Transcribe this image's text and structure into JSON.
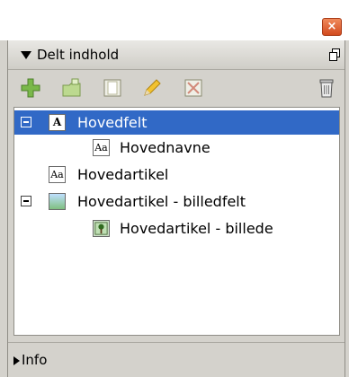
{
  "panel": {
    "title": "Delt indhold",
    "close_label": "×"
  },
  "toolbar": {
    "icons": [
      "plus-icon",
      "new-folder-icon",
      "frame-icon",
      "pencil-icon",
      "unlink-icon",
      "trash-icon"
    ]
  },
  "tree": {
    "items": [
      {
        "label": "Hovedfelt",
        "icon": "A",
        "selected": true
      },
      {
        "label": "Hovednavne",
        "icon": "Aa"
      },
      {
        "label": "Hovedartikel",
        "icon": "Aa"
      },
      {
        "label": "Hovedartikel - billedfelt",
        "icon": "image-frame-icon"
      },
      {
        "label": "Hovedartikel - billede",
        "icon": "picture-icon"
      }
    ]
  },
  "info": {
    "label": "Info"
  },
  "colors": {
    "selection": "#3169c6",
    "panel_bg": "#d4d2cc",
    "close_button": "#e0643a"
  }
}
